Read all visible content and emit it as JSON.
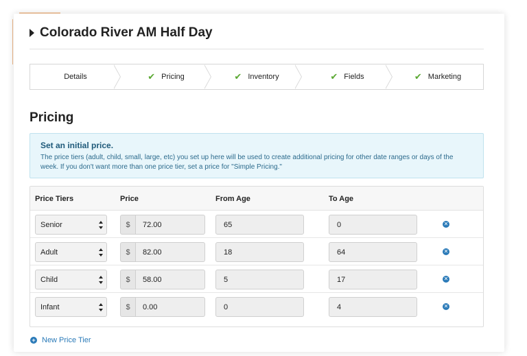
{
  "page": {
    "title": "Colorado River AM Half Day"
  },
  "steps": [
    {
      "label": "Details",
      "completed": false
    },
    {
      "label": "Pricing",
      "completed": true
    },
    {
      "label": "Inventory",
      "completed": true
    },
    {
      "label": "Fields",
      "completed": true
    },
    {
      "label": "Marketing",
      "completed": true
    }
  ],
  "section": {
    "title": "Pricing"
  },
  "info": {
    "title": "Set an initial price.",
    "text": "The price tiers (adult, child, small, large, etc) you set up here will be used to create additional pricing for other date ranges or days of the week. If you don't want more than one price tier, set a price for \"Simple Pricing.\""
  },
  "table": {
    "headers": {
      "tier": "Price Tiers",
      "price": "Price",
      "from_age": "From Age",
      "to_age": "To Age"
    },
    "currency_symbol": "$",
    "rows": [
      {
        "tier": "Senior",
        "price": "72.00",
        "from_age": "65",
        "to_age": "0"
      },
      {
        "tier": "Adult",
        "price": "82.00",
        "from_age": "18",
        "to_age": "64"
      },
      {
        "tier": "Child",
        "price": "58.00",
        "from_age": "5",
        "to_age": "17"
      },
      {
        "tier": "Infant",
        "price": "0.00",
        "from_age": "0",
        "to_age": "4"
      }
    ]
  },
  "actions": {
    "new_tier_label": "New Price Tier"
  },
  "icons": {
    "title_caret": "caret-right-icon",
    "step_check": "check-icon",
    "row_remove": "remove-circle-icon",
    "add": "plus-circle-icon"
  },
  "colors": {
    "check_green": "#5aa832",
    "link_blue": "#2a7ab8",
    "info_bg": "#e8f6fb",
    "info_title": "#1f5a7a",
    "info_text": "#2b6a8c"
  }
}
